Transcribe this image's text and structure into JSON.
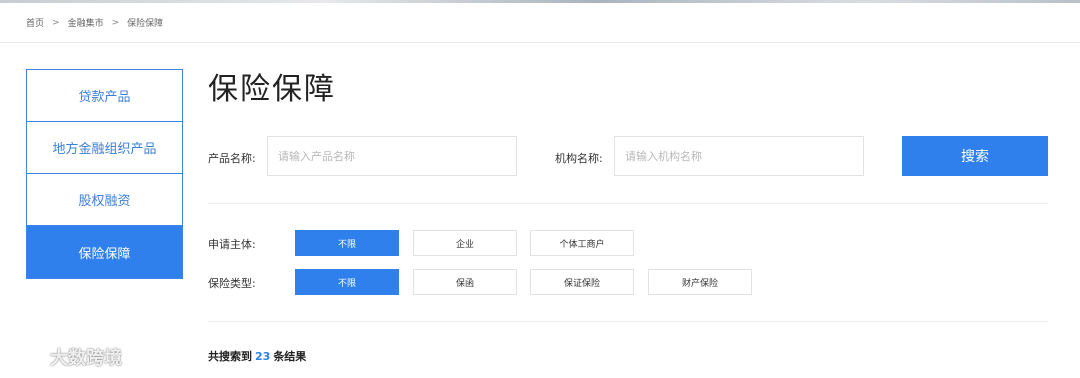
{
  "breadcrumb": {
    "items": [
      "首页",
      "金融集市",
      "保险保障"
    ],
    "separator": ">"
  },
  "sidebar": {
    "items": [
      {
        "label": "贷款产品",
        "active": false
      },
      {
        "label": "地方金融组织产品",
        "active": false
      },
      {
        "label": "股权融资",
        "active": false
      },
      {
        "label": "保险保障",
        "active": true
      }
    ]
  },
  "page_title": "保险保障",
  "search": {
    "product_label": "产品名称:",
    "product_placeholder": "请输入产品名称",
    "org_label": "机构名称:",
    "org_placeholder": "请输入机构名称",
    "button": "搜索"
  },
  "filters": {
    "subject": {
      "label": "申请主体:",
      "options": [
        "不限",
        "企业",
        "个体工商户"
      ],
      "selected": "不限"
    },
    "type": {
      "label": "保险类型:",
      "options": [
        "不限",
        "保函",
        "保证保险",
        "财产保险"
      ],
      "selected": "不限"
    }
  },
  "result": {
    "prefix": "共搜索到",
    "count": "23",
    "suffix": "条结果"
  },
  "watermark": {
    "text": "大数跨境"
  },
  "colors": {
    "accent": "#2f80ed",
    "sidebar_border": "#3d86e6"
  }
}
